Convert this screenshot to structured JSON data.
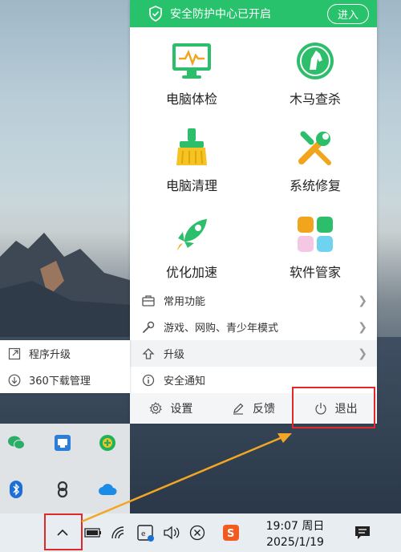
{
  "panel": {
    "status_text": "安全防护中心已开启",
    "enter_label": "进入",
    "tiles": [
      {
        "label": "电脑体检",
        "icon": "monitor-checkup-icon"
      },
      {
        "label": "木马查杀",
        "icon": "trojan-horse-icon"
      },
      {
        "label": "电脑清理",
        "icon": "broom-icon"
      },
      {
        "label": "系统修复",
        "icon": "repair-tools-icon"
      },
      {
        "label": "优化加速",
        "icon": "rocket-icon"
      },
      {
        "label": "软件管家",
        "icon": "app-grid-icon"
      }
    ],
    "menu": [
      {
        "label": "常用功能",
        "icon": "toolbox-icon"
      },
      {
        "label": "游戏、网购、青少年模式",
        "icon": "wrench-icon"
      },
      {
        "label": "升级",
        "icon": "upgrade-arrow-icon"
      },
      {
        "label": "安全通知",
        "icon": "info-icon"
      }
    ],
    "footer": {
      "settings_label": "设置",
      "feedback_label": "反馈",
      "exit_label": "退出"
    }
  },
  "submenu": [
    {
      "label": "程序升级",
      "icon": "export-icon"
    },
    {
      "label": "360下载管理",
      "icon": "download-icon"
    }
  ],
  "taskbar": {
    "time": "19:07 周日",
    "date": "2025/1/19"
  },
  "colors": {
    "brand_green": "#27c26b",
    "highlight_red": "#e0282a",
    "arrow_orange": "#f2a623"
  }
}
